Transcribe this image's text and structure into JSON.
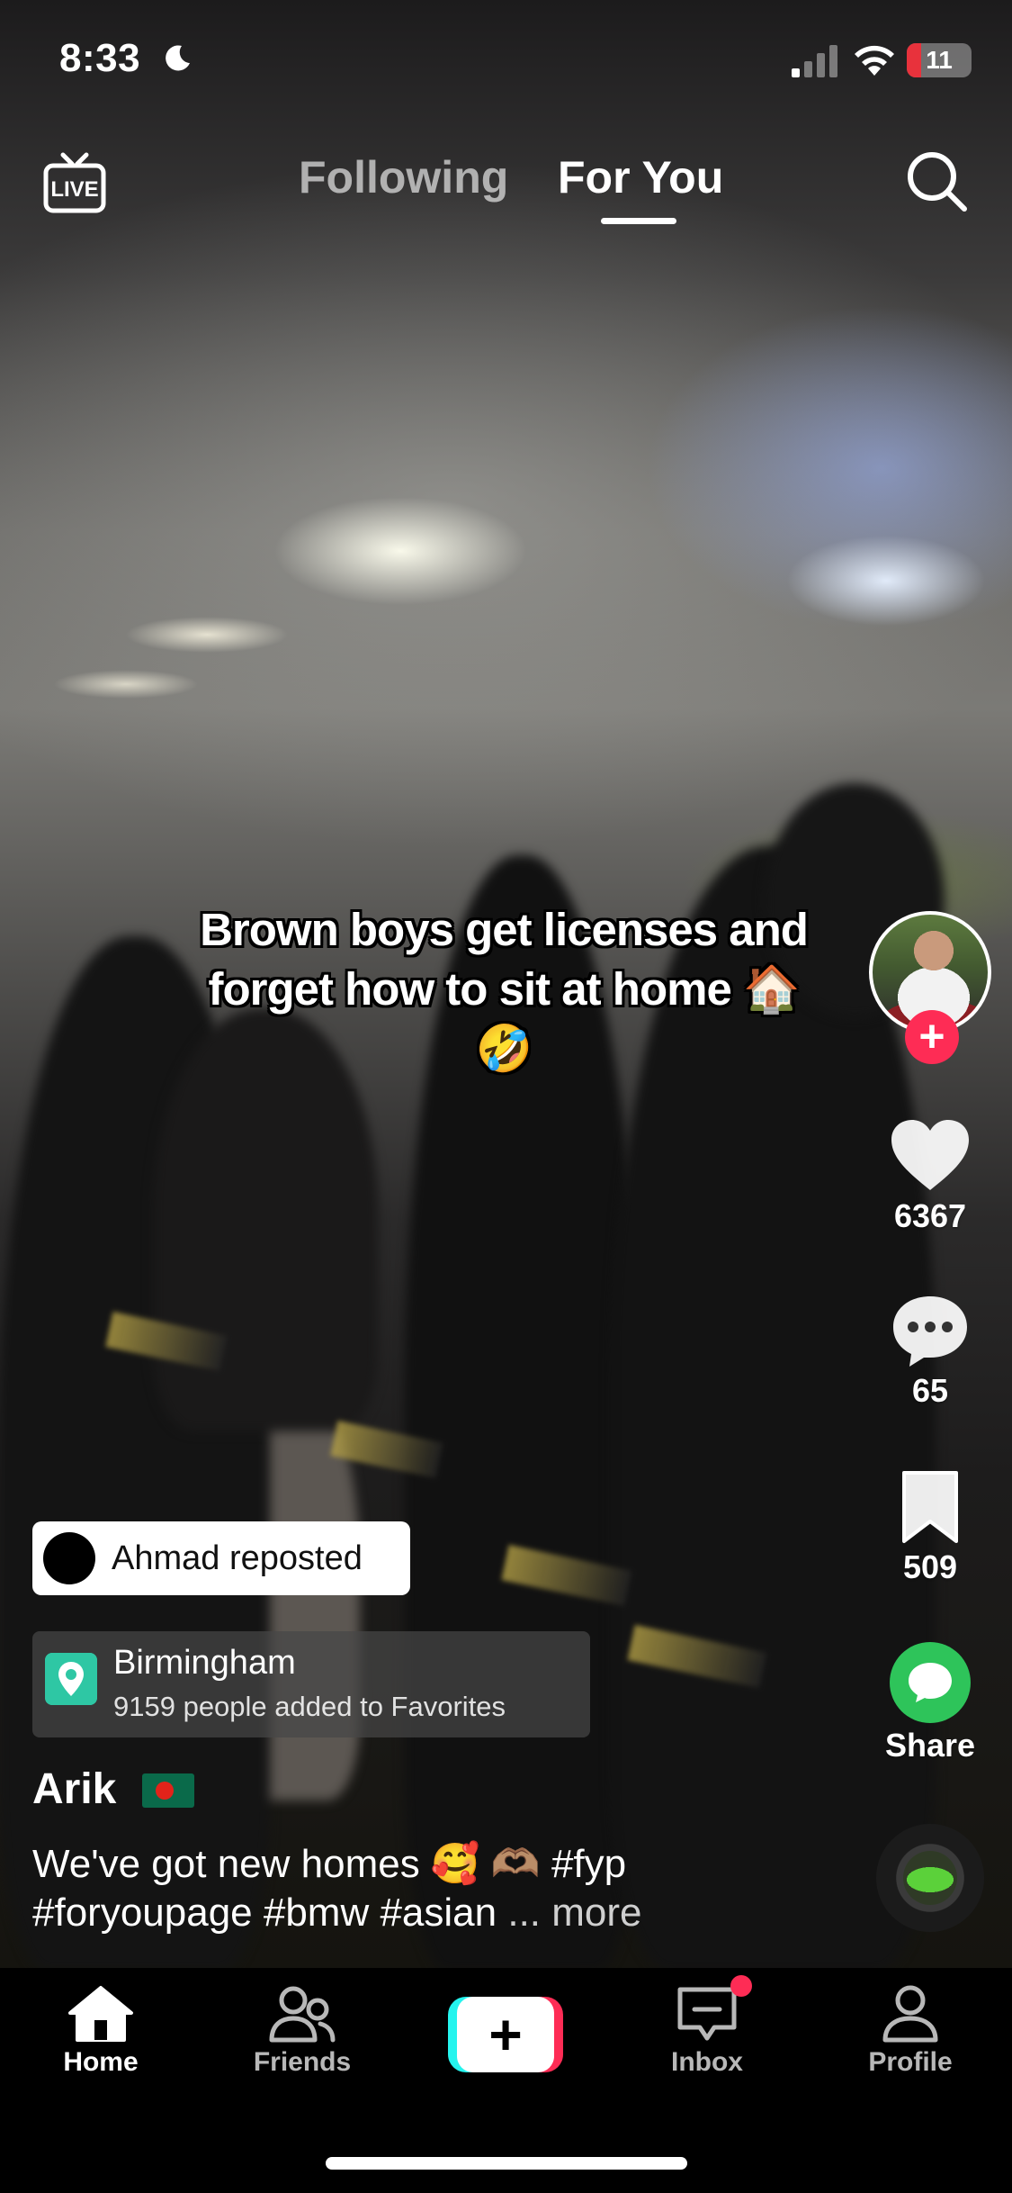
{
  "status_bar": {
    "time": "8:33",
    "battery": "11"
  },
  "top_nav": {
    "tabs": [
      "Following",
      "For You"
    ],
    "active_tab": "For You"
  },
  "video": {
    "caption": "Brown boys get licenses and forget how to sit at home 🏠 🤣"
  },
  "actions": {
    "likes": "6367",
    "comments": "65",
    "bookmarks": "509",
    "share_label": "Share"
  },
  "repost": {
    "text": "Ahmad reposted"
  },
  "location": {
    "name": "Birmingham",
    "subtitle": "9159 people added to Favorites"
  },
  "post": {
    "username": "Arik",
    "description": "We've got new homes 🥰 🫶🏽 #fyp #foryoupage #bmw #asian",
    "more_label": "... more"
  },
  "tab_bar": {
    "home": "Home",
    "friends": "Friends",
    "inbox": "Inbox",
    "profile": "Profile",
    "create_symbol": "+"
  },
  "colors": {
    "accent_red": "#fe2c55",
    "accent_cyan": "#25f4ee",
    "share_green": "#2ec45a",
    "location_teal": "#2ec7a4"
  },
  "icons": [
    "moon-icon",
    "signal-icon",
    "wifi-icon",
    "live-icon",
    "search-icon",
    "heart-icon",
    "comment-icon",
    "bookmark-icon",
    "share-icon",
    "location-pin-icon",
    "flag-icon",
    "home-icon",
    "friends-icon",
    "inbox-icon",
    "profile-icon"
  ]
}
